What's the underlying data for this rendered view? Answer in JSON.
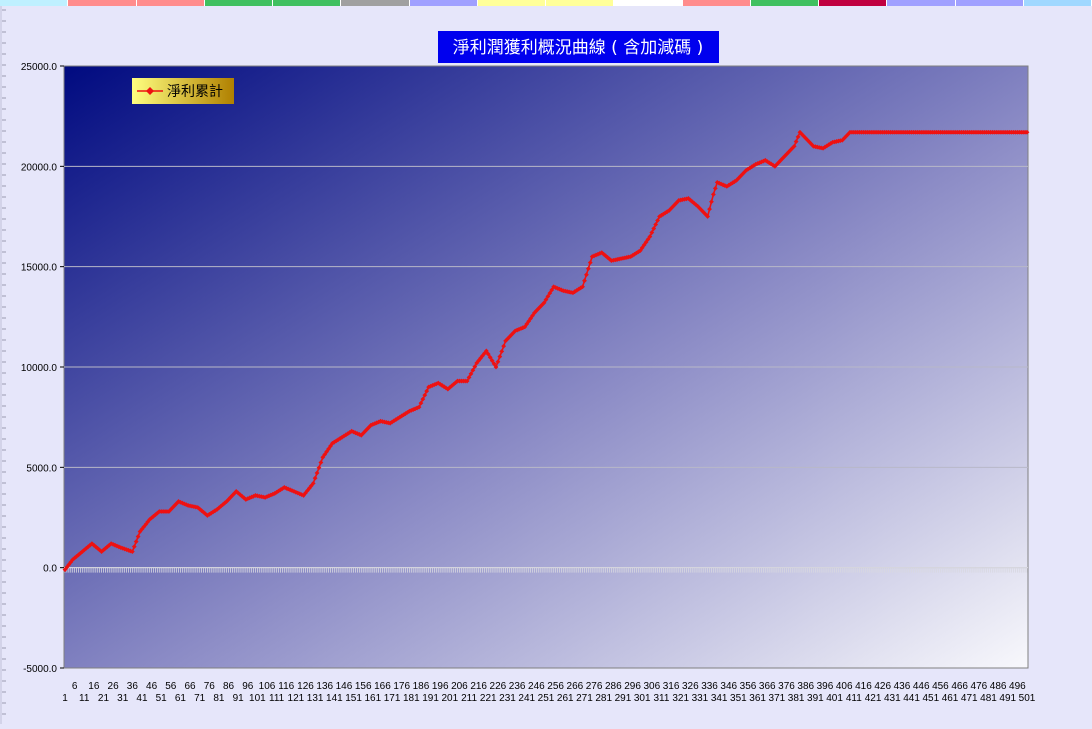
{
  "top_strip_colors": [
    "#bff0ff",
    "#ff8c8c",
    "#ff8c8c",
    "#40c060",
    "#40c060",
    "#a0a0a0",
    "#a0a0ff",
    "#ffff99",
    "#ffff99",
    "#ffffff",
    "#ff8c8c",
    "#40c060",
    "#c00040",
    "#a0a0ff",
    "#a0a0ff",
    "#a0d8ff"
  ],
  "colors": {
    "background": "#e6e6fa",
    "plot_gradient_start": "#000a80",
    "plot_gradient_end": "#f8f8fc",
    "series_line": "#ee1111",
    "title_box": "#0000ee",
    "legend_gradient_start": "#ffff80",
    "legend_gradient_end": "#b08000",
    "gridline": "#b8b8c8"
  },
  "chart_data": {
    "type": "line",
    "title": "淨利潤獲利概況曲線 ( 含加減碼 )",
    "xlabel": "",
    "ylabel": "",
    "ylim": [
      -5000,
      25000
    ],
    "y_ticks": [
      "25000.0",
      "20000.0",
      "15000.0",
      "10000.0",
      "5000.0",
      "0.0",
      "-5000.0"
    ],
    "x_ticks_upper": [
      "6",
      "16",
      "26",
      "36",
      "46",
      "56",
      "66",
      "76",
      "86",
      "96",
      "106",
      "116",
      "126",
      "136",
      "146",
      "156",
      "166",
      "176",
      "186",
      "196",
      "206",
      "216",
      "226",
      "236",
      "246",
      "256",
      "266",
      "276",
      "286",
      "296",
      "306",
      "316",
      "326",
      "336",
      "346",
      "356",
      "366",
      "376",
      "386",
      "396",
      "406",
      "416",
      "426",
      "436",
      "446",
      "456",
      "466",
      "476",
      "486",
      "496"
    ],
    "x_ticks_lower": [
      "1",
      "11",
      "21",
      "31",
      "41",
      "51",
      "61",
      "71",
      "81",
      "91",
      "101",
      "111",
      "121",
      "131",
      "141",
      "151",
      "161",
      "171",
      "181",
      "191",
      "201",
      "211",
      "221",
      "231",
      "241",
      "251",
      "261",
      "271",
      "281",
      "291",
      "301",
      "311",
      "321",
      "331",
      "341",
      "351",
      "361",
      "371",
      "381",
      "391",
      "401",
      "411",
      "421",
      "431",
      "441",
      "451",
      "461",
      "471",
      "481",
      "491",
      "501"
    ],
    "x_count": 501,
    "grid": true,
    "legend_position": "top-left",
    "series": [
      {
        "name": "淨利累計",
        "color": "#ee1111",
        "marker": "diamond",
        "x": [
          1,
          5,
          10,
          15,
          20,
          25,
          30,
          36,
          40,
          45,
          50,
          55,
          60,
          65,
          70,
          75,
          80,
          85,
          90,
          95,
          100,
          105,
          110,
          115,
          120,
          125,
          130,
          135,
          140,
          145,
          150,
          155,
          160,
          165,
          170,
          175,
          180,
          185,
          190,
          195,
          200,
          205,
          210,
          215,
          220,
          225,
          230,
          235,
          240,
          245,
          250,
          255,
          260,
          265,
          270,
          275,
          280,
          285,
          290,
          295,
          300,
          305,
          310,
          315,
          320,
          325,
          330,
          335,
          338,
          340,
          345,
          350,
          355,
          360,
          365,
          370,
          375,
          380,
          383,
          386,
          390,
          395,
          400,
          405,
          407,
          408,
          409,
          410,
          411,
          501
        ],
        "values": [
          -100,
          400,
          800,
          1200,
          800,
          1200,
          1000,
          800,
          1800,
          2400,
          2800,
          2800,
          3300,
          3100,
          3000,
          2600,
          2900,
          3300,
          3800,
          3400,
          3600,
          3500,
          3700,
          4000,
          3800,
          3600,
          4200,
          5500,
          6200,
          6500,
          6800,
          6600,
          7100,
          7300,
          7200,
          7500,
          7800,
          8000,
          9000,
          9200,
          8900,
          9300,
          9300,
          10200,
          10800,
          10000,
          11300,
          11800,
          12000,
          12700,
          13200,
          14000,
          13800,
          13700,
          14000,
          15500,
          15700,
          15300,
          15400,
          15500,
          15800,
          16500,
          17500,
          17800,
          18300,
          18400,
          18000,
          17500,
          18600,
          19200,
          19000,
          19300,
          19800,
          20100,
          20300,
          20000,
          20500,
          21000,
          21700,
          21400,
          21000,
          20900,
          21200,
          21300,
          21500,
          21600,
          21700,
          21700,
          21700,
          21700
        ]
      }
    ]
  }
}
